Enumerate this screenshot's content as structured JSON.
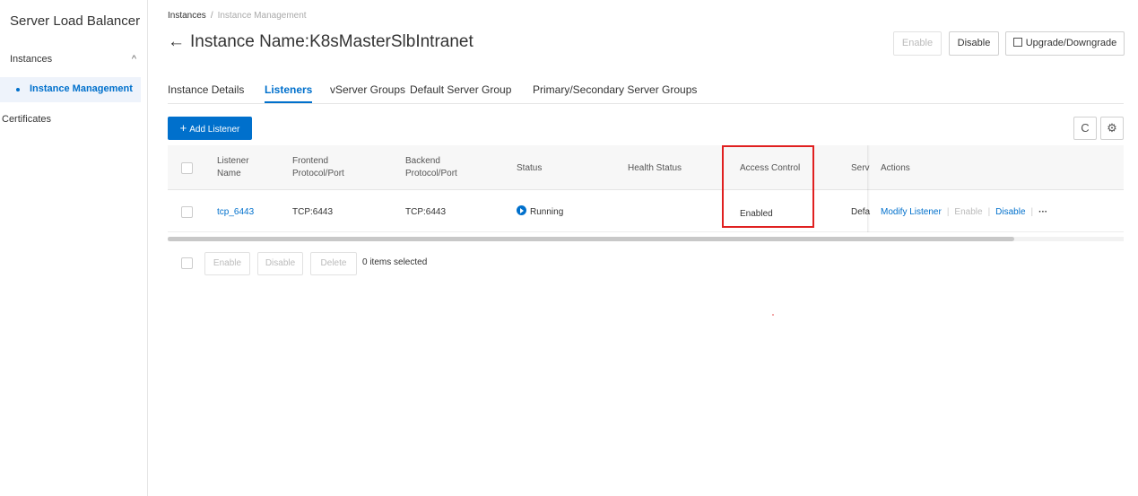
{
  "sidebar": {
    "app_title": "Server Load Balancer",
    "group_label": "Instances",
    "group_chevron": "^",
    "active_item": "Instance Management",
    "certificates": "Certificates"
  },
  "header": {
    "breadcrumb_root": "Instances",
    "breadcrumb_sep": "/",
    "breadcrumb_current": "Instance Management",
    "back_arrow": "←",
    "title": "Instance Name:K8sMasterSlbIntranet",
    "enable_label": "Enable",
    "disable_label": "Disable",
    "upgrade_label": "Upgrade/Downgrade"
  },
  "tabs": [
    {
      "label": "Instance Details"
    },
    {
      "label": "Listeners"
    },
    {
      "label": "vServer Groups"
    },
    {
      "label": "Default Server Group"
    },
    {
      "label": "Primary/Secondary Server Groups"
    }
  ],
  "toolbar": {
    "add_plus": "+",
    "add_label": "Add Listener",
    "refresh_glyph": "C",
    "settings_glyph": "⚙"
  },
  "table": {
    "headers": {
      "listener_name_1": "Listener",
      "listener_name_2": "Name",
      "frontend_1": "Frontend",
      "frontend_2": "Protocol/Port",
      "backend_1": "Backend",
      "backend_2": "Protocol/Port",
      "status": "Status",
      "health": "Health Status",
      "access_control": "Access Control",
      "server_group": "Serv",
      "actions": "Actions"
    },
    "row": {
      "name": "tcp_6443",
      "frontend": "TCP:6443",
      "backend": "TCP:6443",
      "status": "Running",
      "health": "",
      "access_control": "Enabled",
      "server_group": "Defa",
      "action_modify": "Modify Listener",
      "action_enable": "Enable",
      "action_disable": "Disable",
      "action_more": "···",
      "pipe": "|"
    }
  },
  "bulk": {
    "enable": "Enable",
    "disable": "Disable",
    "delete": "Delete",
    "selected": "0 items selected"
  },
  "colors": {
    "accent": "#0070cc",
    "highlight": "#e02020"
  }
}
